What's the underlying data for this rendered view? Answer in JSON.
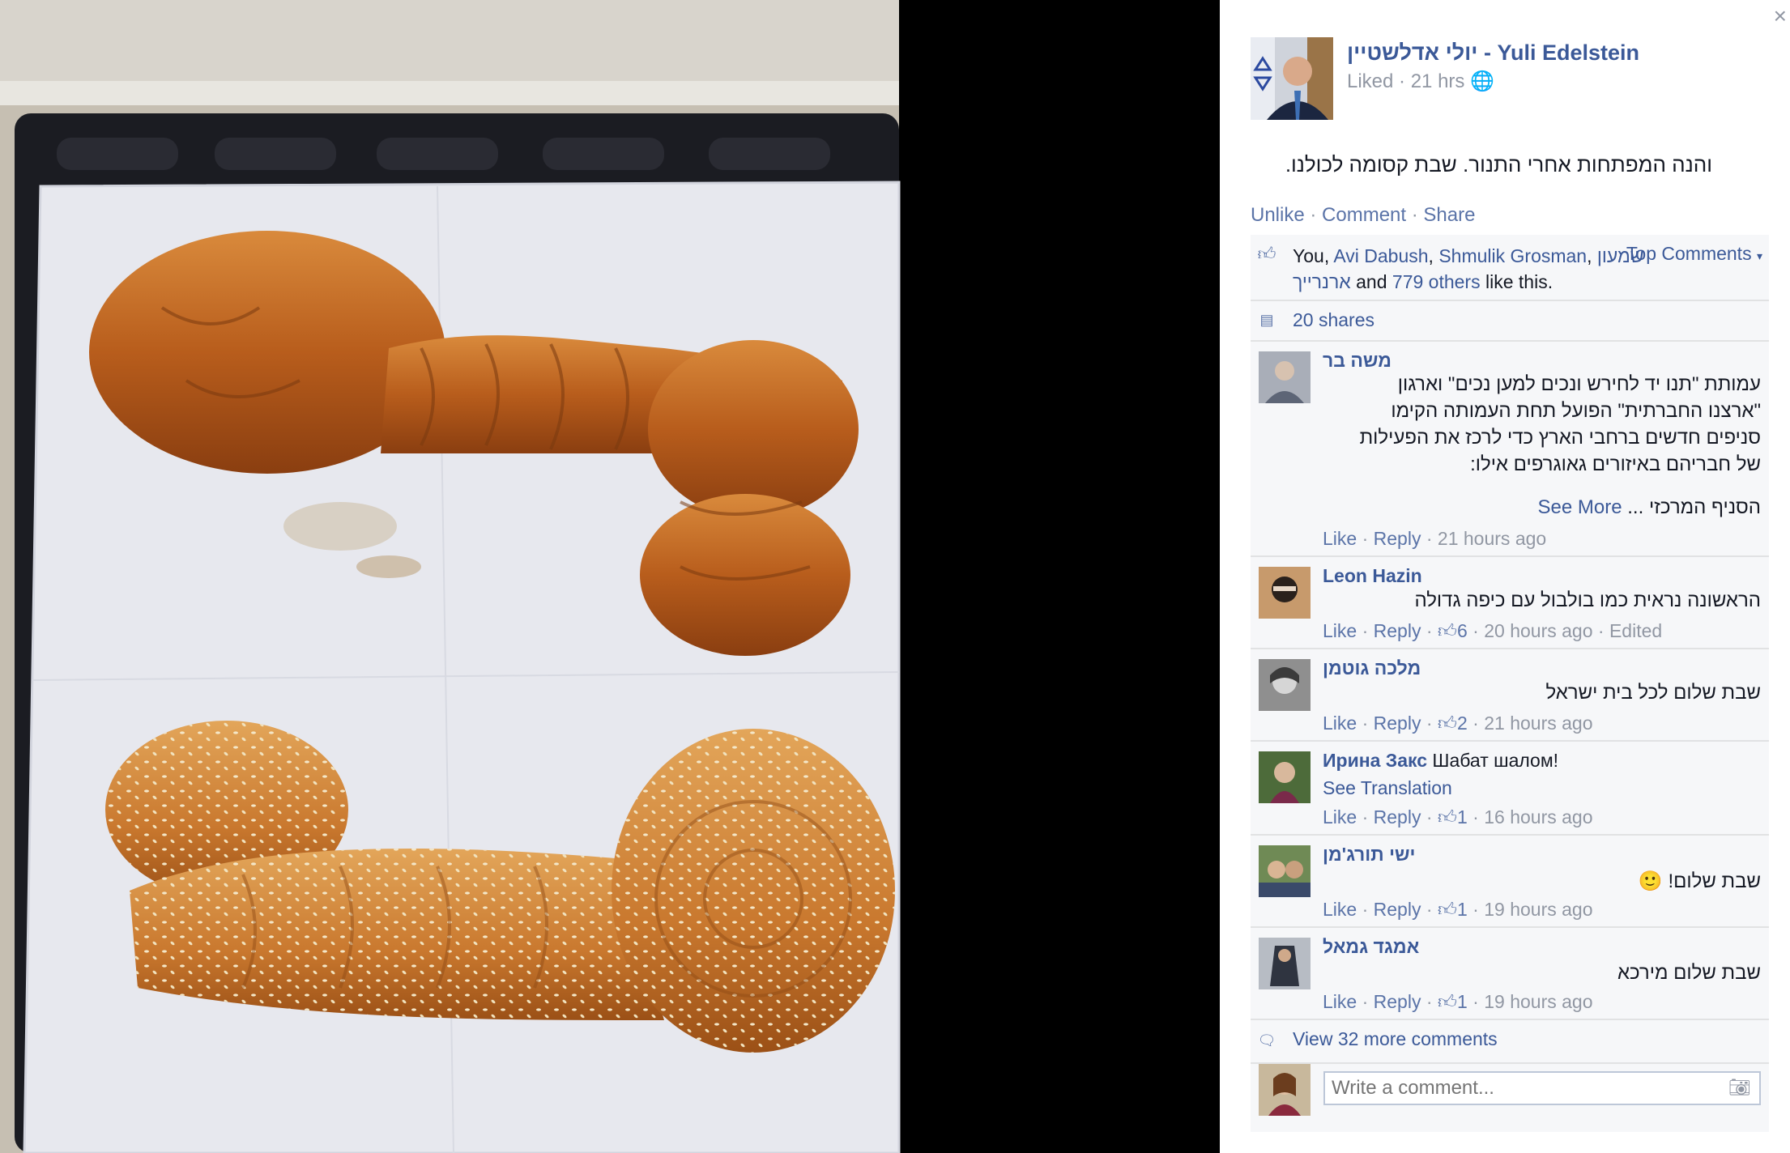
{
  "close_label": "×",
  "post": {
    "author": "יולי אדלשטיין - Yuli Edelstein",
    "status": "Liked",
    "time": "21 hrs",
    "text": "והנה המפתחות אחרי התנור. שבת קסומה לכולנו.",
    "actions": {
      "unlike": "Unlike",
      "comment": "Comment",
      "share": "Share"
    }
  },
  "likes": {
    "you": "You,",
    "name1": "Avi Dabush",
    "comma1": ",",
    "name2a": "Shmulik",
    "name2b": "Grosman",
    "comma2": ",",
    "name3": "שמעון ארנרייך",
    "and": "and",
    "others": "779 others",
    "like_this": "like this.",
    "top_comments": "Top Comments"
  },
  "shares": "20 shares",
  "comments": [
    {
      "name": "משה בר",
      "lines": [
        "עמותת \"תנו יד לחירש ונכים למען נכים\" וארגון",
        "\"ארצנו החברתית\" הפועל תחת העמותה הקימו",
        "סניפים חדשים ברחבי הארץ כדי לרכז את הפעילות",
        "של חבריהם באיזורים גאוגרפים אילו:"
      ],
      "extra": "הסניף המרכזי ...",
      "see_more": "See More",
      "like": "Like",
      "reply": "Reply",
      "time": "21 hours ago"
    },
    {
      "name": "Leon Hazin",
      "text": "הראשונה נראית כמו בולבול עם כיפה גדולה",
      "like": "Like",
      "reply": "Reply",
      "likes": "6",
      "time": "20 hours ago",
      "edited": "Edited"
    },
    {
      "name": "מלכה גוטמן",
      "text": "שבת שלום לכל בית ישראל",
      "like": "Like",
      "reply": "Reply",
      "likes": "2",
      "time": "21 hours ago"
    },
    {
      "name": "Ирина Закс",
      "text": "Шабат шалом!",
      "see_translation": "See Translation",
      "like": "Like",
      "reply": "Reply",
      "likes": "1",
      "time": "16 hours ago"
    },
    {
      "name": "ישי תורג'מן",
      "text": "שבת שלום!",
      "emoji": "🙂",
      "like": "Like",
      "reply": "Reply",
      "likes": "1",
      "time": "19 hours ago"
    },
    {
      "name": "אמגד גמאל",
      "text": "שבת שלום מירכא",
      "like": "Like",
      "reply": "Reply",
      "likes": "1",
      "time": "19 hours ago"
    }
  ],
  "view_more": "View 32 more comments",
  "write_placeholder": "Write a comment...",
  "colors": {
    "link": "#3b5998",
    "grey": "#9197a3",
    "ufi_bg": "#f6f7f9"
  }
}
